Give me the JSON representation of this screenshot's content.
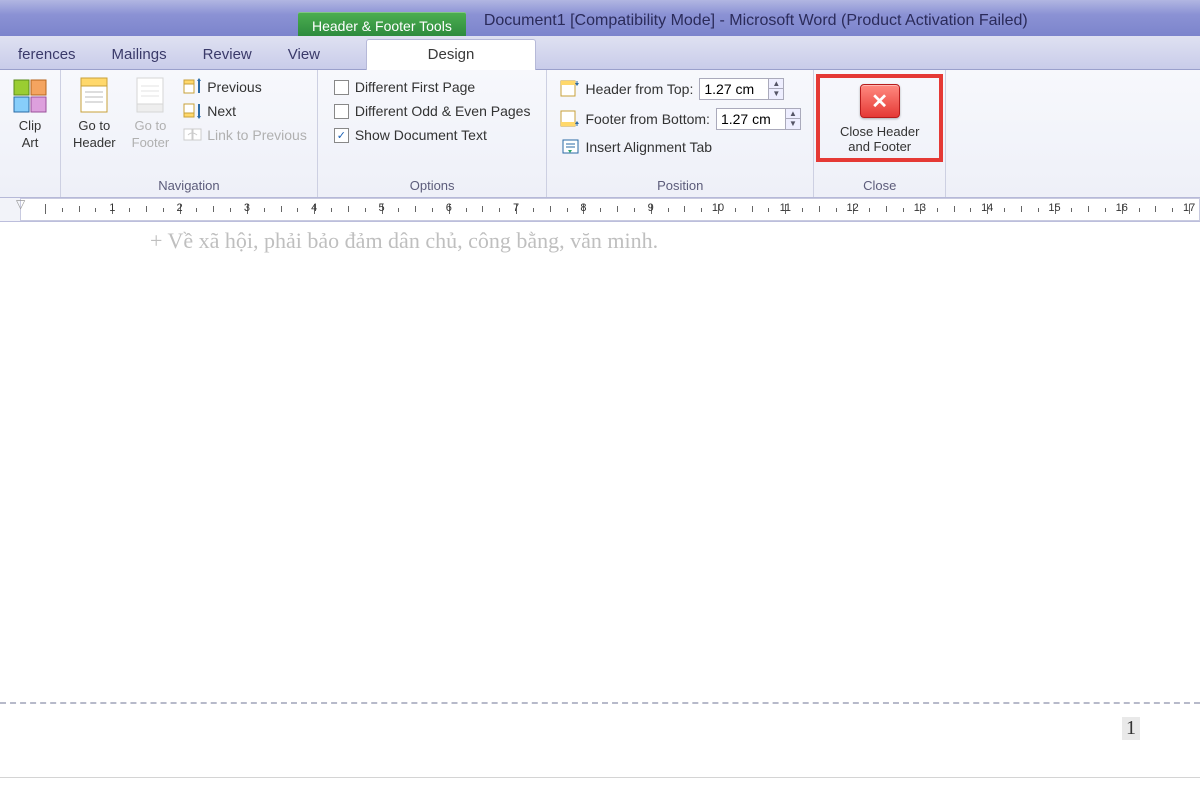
{
  "title_bar": {
    "contextual_tab": "Header & Footer Tools",
    "window_title": "Document1 [Compatibility Mode] - Microsoft Word (Product Activation Failed)"
  },
  "tabs": {
    "references": "ferences",
    "mailings": "Mailings",
    "review": "Review",
    "view": "View",
    "design": "Design"
  },
  "ribbon": {
    "clip_art": "Clip\nArt",
    "goto_header": "Go to\nHeader",
    "goto_footer": "Go to\nFooter",
    "previous": "Previous",
    "next": "Next",
    "link_previous": "Link to Previous",
    "navigation_label": "Navigation",
    "diff_first": "Different First Page",
    "diff_odd_even": "Different Odd & Even Pages",
    "show_doc": "Show Document Text",
    "show_doc_checked": "✓",
    "options_label": "Options",
    "header_from_top": "Header from Top:",
    "footer_from_bottom": "Footer from Bottom:",
    "insert_align_tab": "Insert Alignment Tab",
    "header_value": "1.27 cm",
    "footer_value": "1.27 cm",
    "position_label": "Position",
    "close_header_footer": "Close Header\nand Footer",
    "close_label": "Close"
  },
  "ruler": {
    "marks": [
      1,
      2,
      3,
      4,
      5,
      6,
      7,
      8,
      9,
      10,
      11,
      12,
      13,
      14,
      15,
      16,
      17
    ]
  },
  "document": {
    "body_text": "+    Về xã hội, phải bảo đảm dân chủ, công bằng, văn minh.",
    "page_number": "1"
  }
}
